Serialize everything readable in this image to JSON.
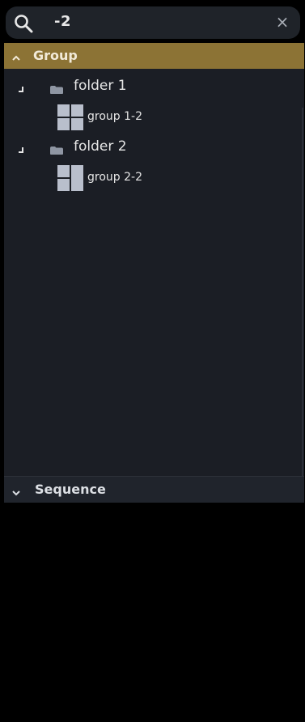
{
  "search": {
    "value": "-2",
    "clear_symbol": "×",
    "search_icon": "magnifier-icon",
    "clear_icon": "close-icon"
  },
  "group_section": {
    "label": "Group",
    "chevron_icon": "chevron-up-icon",
    "header_color": "#8c7335",
    "tree": [
      {
        "type": "folder",
        "label": "folder 1",
        "icon": "folder-icon",
        "children": [
          {
            "type": "group",
            "label": "group 1-2",
            "icon": "grid-2x2-icon"
          }
        ]
      },
      {
        "type": "folder",
        "label": "folder 2",
        "icon": "folder-icon",
        "children": [
          {
            "type": "group",
            "label": "group 2-2",
            "icon": "grid-split-icon"
          }
        ]
      }
    ]
  },
  "sequence_section": {
    "label": "Sequence",
    "chevron_icon": "chevron-down-icon"
  },
  "colors": {
    "panel_bg": "#1b1e25",
    "search_bg": "#1f2329",
    "accent": "#8c7335",
    "text": "#e6e6e6"
  }
}
